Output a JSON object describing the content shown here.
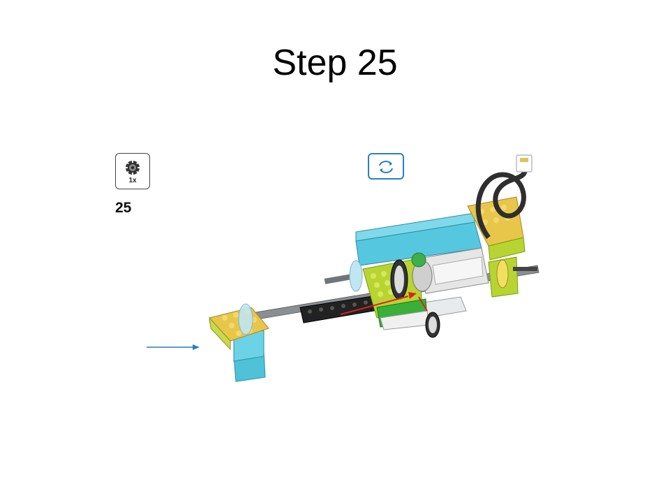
{
  "slide": {
    "title": "Step 25"
  },
  "parts_callout": {
    "quantity": "1x",
    "icon": "gear-icon"
  },
  "step_number": "25",
  "rotate_icon": "rotate-model-icon",
  "colors": {
    "lime": "#b8d432",
    "azure": "#5ccbe0",
    "yellow": "#e8c64a",
    "black": "#222222",
    "arrow_blue": "#2a7fc0",
    "arrow_red": "#e02020"
  }
}
